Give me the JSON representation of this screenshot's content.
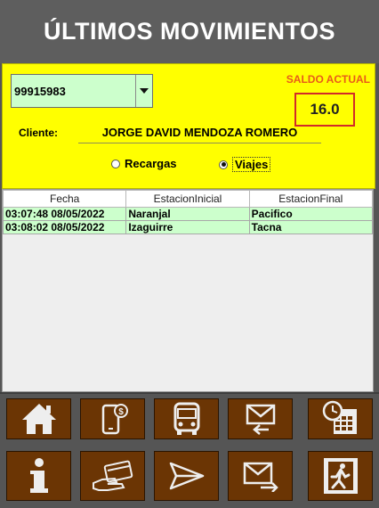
{
  "header": {
    "title": "ÚLTIMOS MOVIMIENTOS"
  },
  "account": {
    "card_number": "99915983",
    "saldo_label": "SALDO ACTUAL",
    "saldo_value": "16.0",
    "cliente_label": "Cliente:",
    "cliente_name": "JORGE DAVID MENDOZA ROMERO"
  },
  "filter": {
    "options": [
      {
        "label": "Recargas",
        "selected": false
      },
      {
        "label": "Viajes",
        "selected": true
      }
    ]
  },
  "table": {
    "columns": [
      "Fecha",
      "EstacionInicial",
      "EstacionFinal"
    ],
    "rows": [
      [
        "03:07:48 08/05/2022",
        "Naranjal",
        "Pacifico"
      ],
      [
        "03:08:02 08/05/2022",
        "Izaguirre",
        "Tacna"
      ]
    ]
  },
  "buttons": [
    {
      "icon": "home-icon"
    },
    {
      "icon": "mobile-payment-icon"
    },
    {
      "icon": "bus-icon"
    },
    {
      "icon": "message-reply-icon"
    },
    {
      "icon": "calendar-clock-icon"
    },
    {
      "icon": "info-icon"
    },
    {
      "icon": "card-payment-icon"
    },
    {
      "icon": "send-icon"
    },
    {
      "icon": "mail-forward-icon"
    },
    {
      "icon": "exit-icon"
    }
  ],
  "colors": {
    "panel_yellow": "#ffff00",
    "row_green": "#ccffcc",
    "tile_brown": "#6b3504",
    "saldo_orange": "#e85b1a",
    "saldo_border": "#d12a2a",
    "title_bg": "#5e5e5e"
  }
}
